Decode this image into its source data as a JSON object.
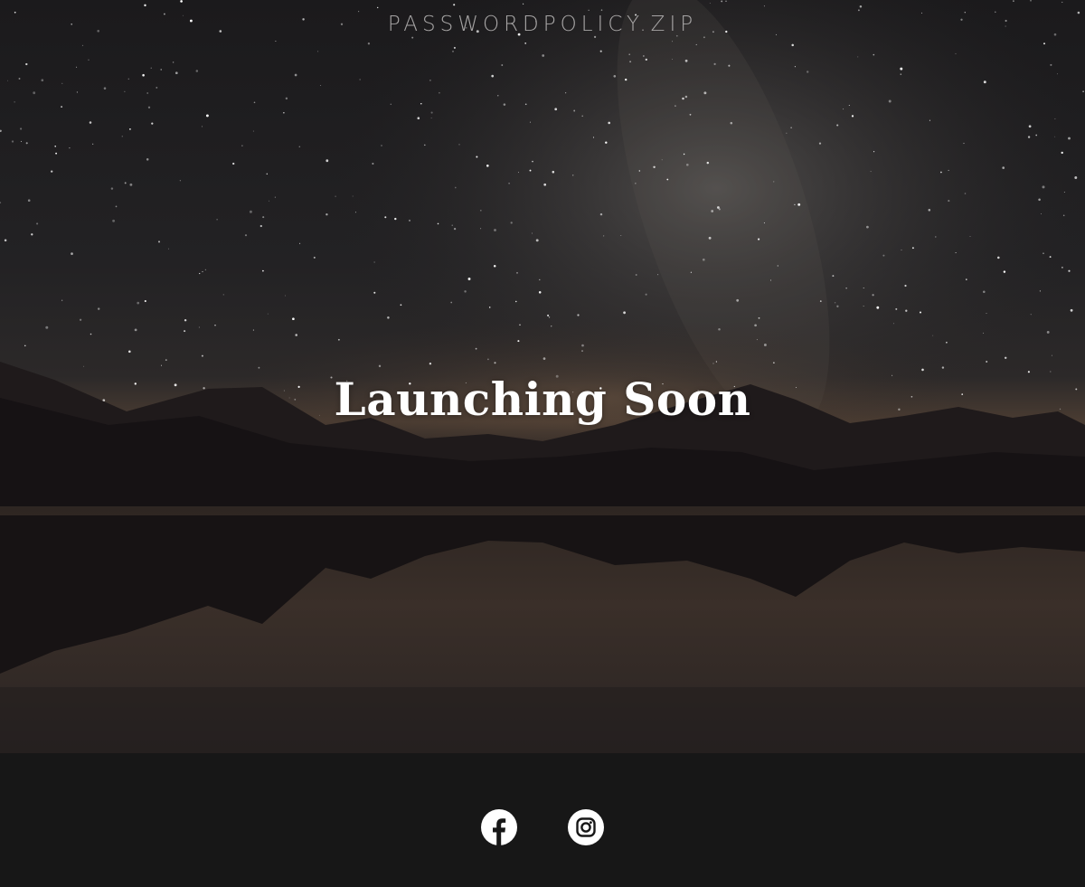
{
  "site": {
    "name": "PASSWORDPOLICY.ZIP"
  },
  "hero": {
    "headline": "Launching Soon"
  },
  "footer": {
    "social": [
      {
        "icon": "facebook-icon",
        "label": "Facebook"
      },
      {
        "icon": "instagram-icon",
        "label": "Instagram"
      }
    ]
  },
  "colors": {
    "footer_bg": "#171717",
    "headline": "#ffffff",
    "site_name": "#a7a5a5",
    "icon": "#ffffff"
  }
}
